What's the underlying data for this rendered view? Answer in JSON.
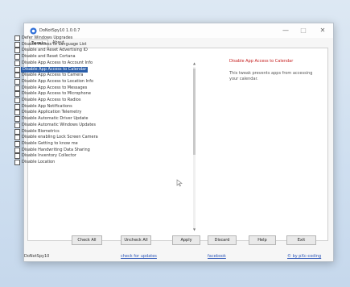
{
  "window": {
    "title": "DoNotSpy10 1.0.0.7"
  },
  "tabs": [
    {
      "label": "Tweaks"
    },
    {
      "label": "About"
    }
  ],
  "tweaks": [
    {
      "label": "Defer Windows Upgrades",
      "checked": false,
      "selected": false
    },
    {
      "label": "Disable Access to Language List",
      "checked": false,
      "selected": false
    },
    {
      "label": "Disable and Reset Advertising ID",
      "checked": false,
      "selected": false
    },
    {
      "label": "Disable and Reset Cortana",
      "checked": false,
      "selected": false
    },
    {
      "label": "Disable App Access to Account Info",
      "checked": false,
      "selected": false
    },
    {
      "label": "Disable App Access to Calendar",
      "checked": false,
      "selected": true
    },
    {
      "label": "Disable App Access to Camera",
      "checked": false,
      "selected": false
    },
    {
      "label": "Disable App Access to Location Info",
      "checked": false,
      "selected": false
    },
    {
      "label": "Disable App Access to Messages",
      "checked": false,
      "selected": false
    },
    {
      "label": "Disable App Access to Microphone",
      "checked": false,
      "selected": false
    },
    {
      "label": "Disable App Access to Radios",
      "checked": false,
      "selected": false
    },
    {
      "label": "Disable App Notifications",
      "checked": false,
      "selected": false
    },
    {
      "label": "Disable Application Telemetry",
      "checked": false,
      "selected": false
    },
    {
      "label": "Disable Automatic Driver Update",
      "checked": false,
      "selected": false
    },
    {
      "label": "Disable Automatic Windows Updates",
      "checked": false,
      "selected": false
    },
    {
      "label": "Disable Biometrics",
      "checked": false,
      "selected": false
    },
    {
      "label": "Disable enabling Lock Screen Camera",
      "checked": false,
      "selected": false
    },
    {
      "label": "Disable Getting to know me",
      "checked": false,
      "selected": false
    },
    {
      "label": "Disable Handwriting Data Sharing",
      "checked": false,
      "selected": false
    },
    {
      "label": "Disable Inventory Collector",
      "checked": false,
      "selected": false
    },
    {
      "label": "Disable Location",
      "checked": false,
      "selected": false
    }
  ],
  "description": {
    "title": "Disable App Access to Calendar",
    "text": "This tweak prevents apps from accessing your calendar."
  },
  "buttons": {
    "check_all": "Check All",
    "uncheck_all": "Uncheck All",
    "apply": "Apply",
    "discard": "Discard",
    "help": "Help",
    "exit": "Exit"
  },
  "status": {
    "app_name": "DoNotSpy10",
    "check_updates": "check for updates",
    "facebook": "facebook",
    "author": "© by pXc-coding"
  },
  "colors": {
    "selection": "#2a5da8",
    "desc_title": "#c62020",
    "link": "#2b55b8"
  }
}
